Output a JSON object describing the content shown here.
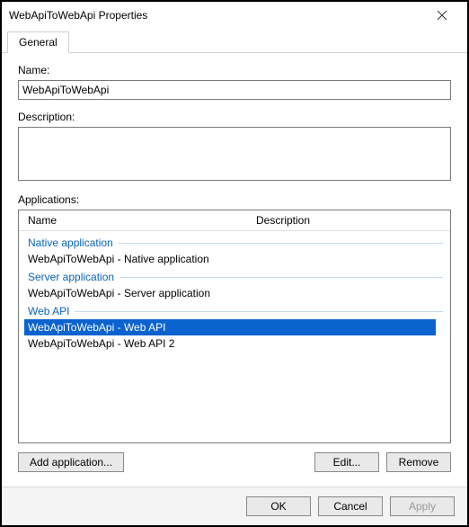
{
  "window": {
    "title": "WebApiToWebApi Properties"
  },
  "tabs": {
    "general": "General"
  },
  "fields": {
    "name_label": "Name:",
    "name_value": "WebApiToWebApi",
    "description_label": "Description:",
    "description_value": "",
    "applications_label": "Applications:"
  },
  "apps_table": {
    "col_name": "Name",
    "col_description": "Description",
    "groups": [
      {
        "header": "Native application",
        "rows": [
          {
            "name": "WebApiToWebApi - Native application",
            "selected": false
          }
        ]
      },
      {
        "header": "Server application",
        "rows": [
          {
            "name": "WebApiToWebApi - Server application",
            "selected": false
          }
        ]
      },
      {
        "header": "Web API",
        "rows": [
          {
            "name": "WebApiToWebApi - Web API",
            "selected": true
          },
          {
            "name": "WebApiToWebApi - Web API 2",
            "selected": false
          }
        ]
      }
    ]
  },
  "buttons": {
    "add_application": "Add application...",
    "edit": "Edit...",
    "remove": "Remove",
    "ok": "OK",
    "cancel": "Cancel",
    "apply": "Apply"
  }
}
